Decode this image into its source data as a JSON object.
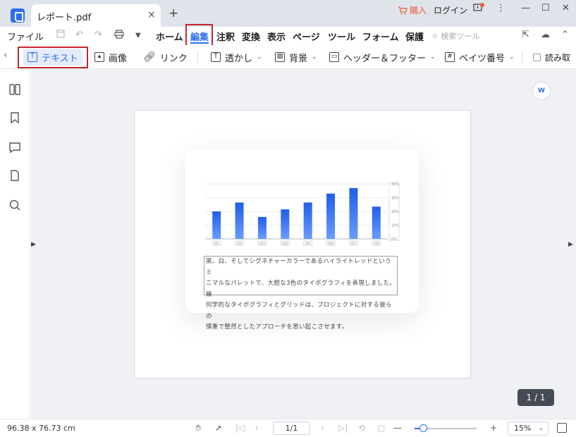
{
  "titlebar": {
    "tab_title": "レポート.pdf",
    "close_glyph": "×",
    "new_tab_glyph": "+",
    "buy_label": "購入",
    "login_label": "ログイン",
    "menu_glyph": "⋮",
    "minimize_glyph": "—",
    "maximize_glyph": "☐",
    "close_window_glyph": "✕"
  },
  "menubar": {
    "file": "ファイル",
    "tabs": [
      "ホーム",
      "編集",
      "注釈",
      "変換",
      "表示",
      "ページ",
      "ツール",
      "フォーム",
      "保護"
    ],
    "active_tab": "編集",
    "search_tools": "検索ツール"
  },
  "toolbar": {
    "text": "テキスト",
    "image": "画像",
    "link": "リンク",
    "watermark": "透かし",
    "background": "背景",
    "header_footer": "ヘッダー＆フッター",
    "bates": "ベイツ番号",
    "read_mode": "読み取"
  },
  "document": {
    "paragraph_lines": [
      "黒、白、そしてシグネチャーカラーであるハイライトレッドというミ",
      "ニマルなパレットで、大胆な3色のタイポグラフィを表現しました。幾",
      "何学的なタイポグラフィとグリッドは、プロジェクトに対する彼らの",
      "慎重で整然としたアプローチを思い起こさせます。"
    ],
    "page_badge": "1 / 1",
    "word_icon_label": "W"
  },
  "chart_data": {
    "type": "bar",
    "categories": [
      "S01",
      "S02",
      "S03",
      "S04",
      "S05",
      "S06",
      "S07",
      "S08"
    ],
    "values": [
      20,
      26.5,
      16,
      21.5,
      26.5,
      33,
      37,
      23.5
    ],
    "ylim": [
      0,
      40
    ],
    "y_tick_labels": [
      "0%",
      "10%",
      "20%",
      "30%",
      "40%"
    ],
    "bar_color": "#2a6ef2",
    "grid": true
  },
  "statusbar": {
    "dimensions": "96.38 x 76.73 cm",
    "page_input": "1/1",
    "zoom": "15%",
    "zoom_fraction": 0.15
  },
  "colors": {
    "accent": "#2a6ef2",
    "highlight_box": "#c8262b",
    "buy": "#e8603d"
  }
}
